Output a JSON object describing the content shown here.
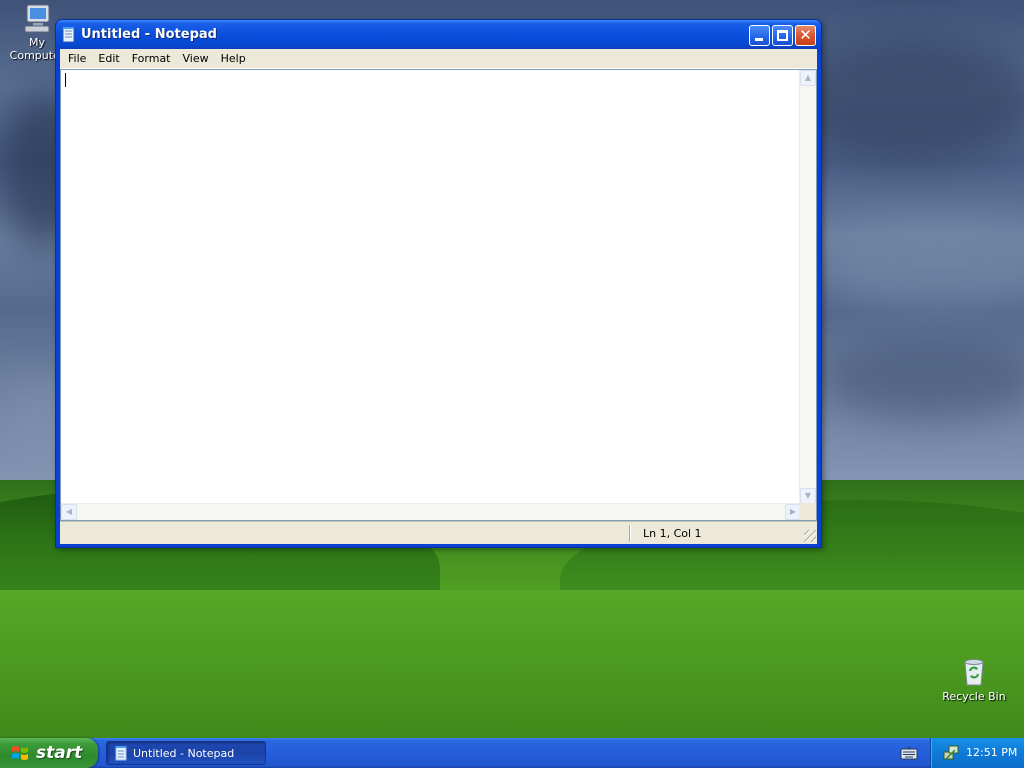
{
  "desktop": {
    "icons": [
      {
        "label": "My Computer",
        "icon": "my-computer-icon"
      },
      {
        "label": "Recycle Bin",
        "icon": "recycle-bin-icon"
      }
    ]
  },
  "window": {
    "title": "Untitled - Notepad",
    "app_icon": "notepad-icon",
    "controls": {
      "minimize": "minimize-button",
      "maximize": "maximize-button",
      "close": "close-button"
    },
    "menu": [
      "File",
      "Edit",
      "Format",
      "View",
      "Help"
    ],
    "editor": {
      "value": ""
    },
    "status": {
      "position": "Ln 1, Col 1"
    }
  },
  "taskbar": {
    "start_label": "start",
    "task_label": "Untitled - Notepad",
    "clock": "12:51 PM",
    "colors": {
      "taskbar": "#245ddb",
      "start": "#3c9c39",
      "tray": "#0f7ad8",
      "title": "#0a4fdc",
      "close": "#d8532c"
    }
  }
}
